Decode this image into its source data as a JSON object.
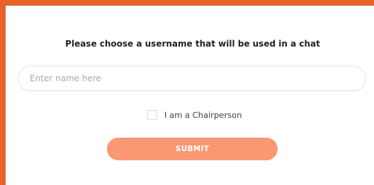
{
  "form": {
    "prompt": "Please choose a username that will be used in a chat",
    "name_input": {
      "value": "",
      "placeholder": "Enter name here"
    },
    "chairperson_checkbox": {
      "label": "I am a Chairperson",
      "checked": false
    },
    "submit_label": "SUBMIT"
  },
  "colors": {
    "accent_border": "#e8622c",
    "submit_button": "#f99872",
    "submit_text": "#ffffff"
  }
}
